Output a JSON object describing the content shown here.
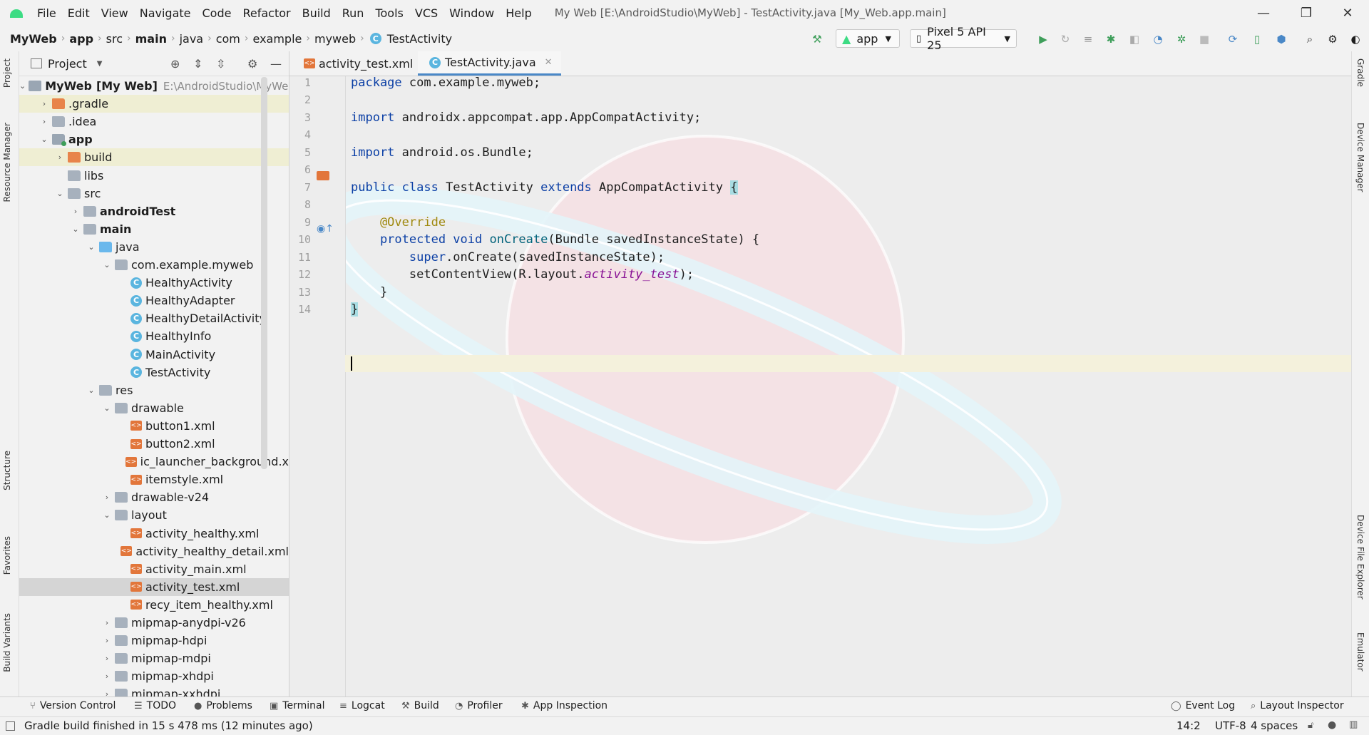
{
  "titlebar": {
    "menu": [
      "File",
      "Edit",
      "View",
      "Navigate",
      "Code",
      "Refactor",
      "Build",
      "Run",
      "Tools",
      "VCS",
      "Window",
      "Help"
    ],
    "window_title": "My Web [E:\\AndroidStudio\\MyWeb] - TestActivity.java [My_Web.app.main]",
    "minimize": "—",
    "restore": "❐",
    "close": "✕"
  },
  "navbar": {
    "breadcrumbs": [
      "MyWeb",
      "app",
      "src",
      "main",
      "java",
      "com",
      "example",
      "myweb",
      "TestActivity"
    ],
    "run_config": "app",
    "device": "Pixel 5 API 25"
  },
  "left_strip": {
    "project": "Project",
    "resource_manager": "Resource Manager",
    "structure": "Structure",
    "favorites": "Favorites",
    "build_variants": "Build Variants"
  },
  "right_strip": {
    "gradle": "Gradle",
    "device_manager": "Device Manager",
    "device_file_explorer": "Device File Explorer",
    "emulator": "Emulator"
  },
  "project_panel": {
    "title": "Project",
    "tree": [
      {
        "label": "MyWeb",
        "suffix": "[My Web]",
        "path": "E:\\AndroidStudio\\MyWeb"
      },
      {
        "label": ".gradle"
      },
      {
        "label": ".idea"
      },
      {
        "label": "app"
      },
      {
        "label": "build"
      },
      {
        "label": "libs"
      },
      {
        "label": "src"
      },
      {
        "label": "androidTest"
      },
      {
        "label": "main"
      },
      {
        "label": "java"
      },
      {
        "label": "com.example.myweb"
      },
      {
        "label": "HealthyActivity"
      },
      {
        "label": "HealthyAdapter"
      },
      {
        "label": "HealthyDetailActivity"
      },
      {
        "label": "HealthyInfo"
      },
      {
        "label": "MainActivity"
      },
      {
        "label": "TestActivity"
      },
      {
        "label": "res"
      },
      {
        "label": "drawable"
      },
      {
        "label": "button1.xml"
      },
      {
        "label": "button2.xml"
      },
      {
        "label": "ic_launcher_background.x"
      },
      {
        "label": "itemstyle.xml"
      },
      {
        "label": "drawable-v24"
      },
      {
        "label": "layout"
      },
      {
        "label": "activity_healthy.xml"
      },
      {
        "label": "activity_healthy_detail.xml"
      },
      {
        "label": "activity_main.xml"
      },
      {
        "label": "activity_test.xml"
      },
      {
        "label": "recy_item_healthy.xml"
      },
      {
        "label": "mipmap-anydpi-v26"
      },
      {
        "label": "mipmap-hdpi"
      },
      {
        "label": "mipmap-mdpi"
      },
      {
        "label": "mipmap-xhdpi"
      },
      {
        "label": "mipmap-xxhdpi"
      }
    ]
  },
  "editor": {
    "tabs": [
      {
        "label": "activity_test.xml"
      },
      {
        "label": "TestActivity.java"
      }
    ],
    "line_numbers": [
      "1",
      "2",
      "3",
      "4",
      "5",
      "6",
      "7",
      "8",
      "9",
      "10",
      "11",
      "12",
      "13",
      "14"
    ],
    "code": {
      "l1_kw": "package",
      "l1_rest": " com.example.myweb;",
      "l3_kw": "import",
      "l3_rest": " androidx.appcompat.app.AppCompatActivity;",
      "l5_kw": "import",
      "l5_rest": " android.os.Bundle;",
      "l7_kw1": "public class",
      "l7_name": " TestActivity ",
      "l7_kw2": "extends",
      "l7_super": " AppCompatActivity ",
      "l7_brace": "{",
      "l9_ann": "    @Override",
      "l10_kw": "    protected void",
      "l10_fn": " onCreate",
      "l10_rest": "(Bundle savedInstanceState) {",
      "l11_kw": "        super",
      "l11_rest": ".onCreate(savedInstanceState);",
      "l12_pre": "        setContentView(R.layout.",
      "l12_ital": "activity_test",
      "l12_post": ");",
      "l13": "    }",
      "l14": "}"
    }
  },
  "bottom_tabs": {
    "version_control": "Version Control",
    "todo": "TODO",
    "problems": "Problems",
    "terminal": "Terminal",
    "logcat": "Logcat",
    "build": "Build",
    "profiler": "Profiler",
    "app_inspection": "App Inspection",
    "event_log": "Event Log",
    "layout_inspector": "Layout Inspector"
  },
  "statusbar": {
    "message": "Gradle build finished in 15 s 478 ms (12 minutes ago)",
    "position": "14:2",
    "encoding": "UTF-8",
    "indent": "4 spaces"
  },
  "colors": {
    "accent": "#4a88c7",
    "android_green": "#3ddc84",
    "keyword": "#0b3fa5",
    "annotation": "#9e880d"
  }
}
